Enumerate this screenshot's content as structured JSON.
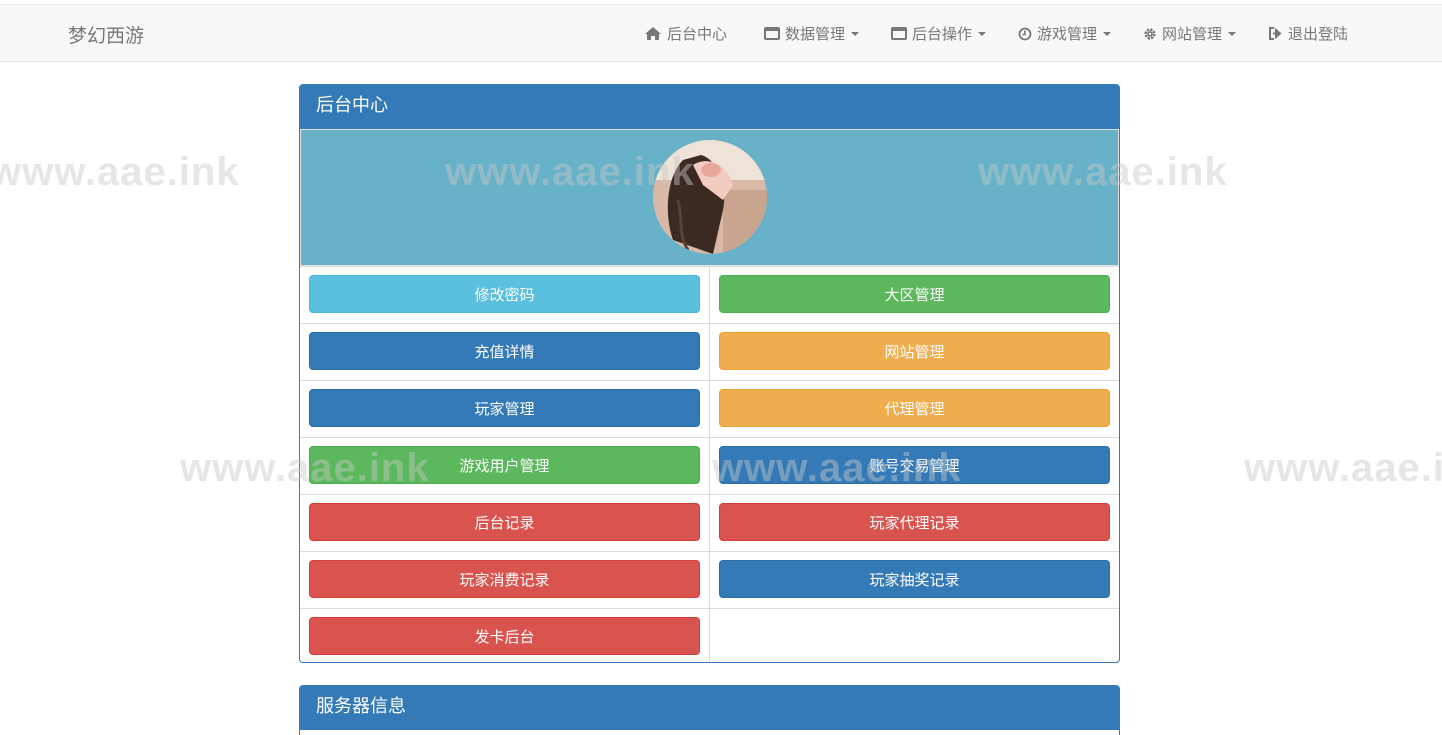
{
  "navbar": {
    "brand": "梦幻西游",
    "items": [
      {
        "label": "后台中心",
        "icon": "home-icon"
      },
      {
        "label": "数据管理",
        "icon": "window-icon"
      },
      {
        "label": "后台操作",
        "icon": "window-icon"
      },
      {
        "label": "游戏管理",
        "icon": "clock-icon"
      },
      {
        "label": "网站管理",
        "icon": "gear-icon"
      },
      {
        "label": "退出登陆",
        "icon": "logout-icon"
      }
    ]
  },
  "watermark": "www.aae.ink",
  "main_panel": {
    "title": "后台中心",
    "buttons": [
      {
        "label": "修改密码",
        "style": "info"
      },
      {
        "label": "大区管理",
        "style": "success"
      },
      {
        "label": "充值详情",
        "style": "primary"
      },
      {
        "label": "网站管理",
        "style": "warning"
      },
      {
        "label": "玩家管理",
        "style": "primary"
      },
      {
        "label": "代理管理",
        "style": "warning"
      },
      {
        "label": "游戏用户管理",
        "style": "success"
      },
      {
        "label": "账号交易管理",
        "style": "primary"
      },
      {
        "label": "后台记录",
        "style": "danger"
      },
      {
        "label": "玩家代理记录",
        "style": "danger"
      },
      {
        "label": "玩家消费记录",
        "style": "danger"
      },
      {
        "label": "玩家抽奖记录",
        "style": "primary"
      },
      {
        "label": "发卡后台",
        "style": "danger"
      }
    ]
  },
  "server_panel": {
    "title": "服务器信息"
  },
  "colors": {
    "primary": "#337ab7",
    "info": "#5bc0de",
    "success": "#5cb85c",
    "warning": "#f0ad4e",
    "danger": "#d9534f",
    "avatar_bg": "#67b1c9"
  }
}
